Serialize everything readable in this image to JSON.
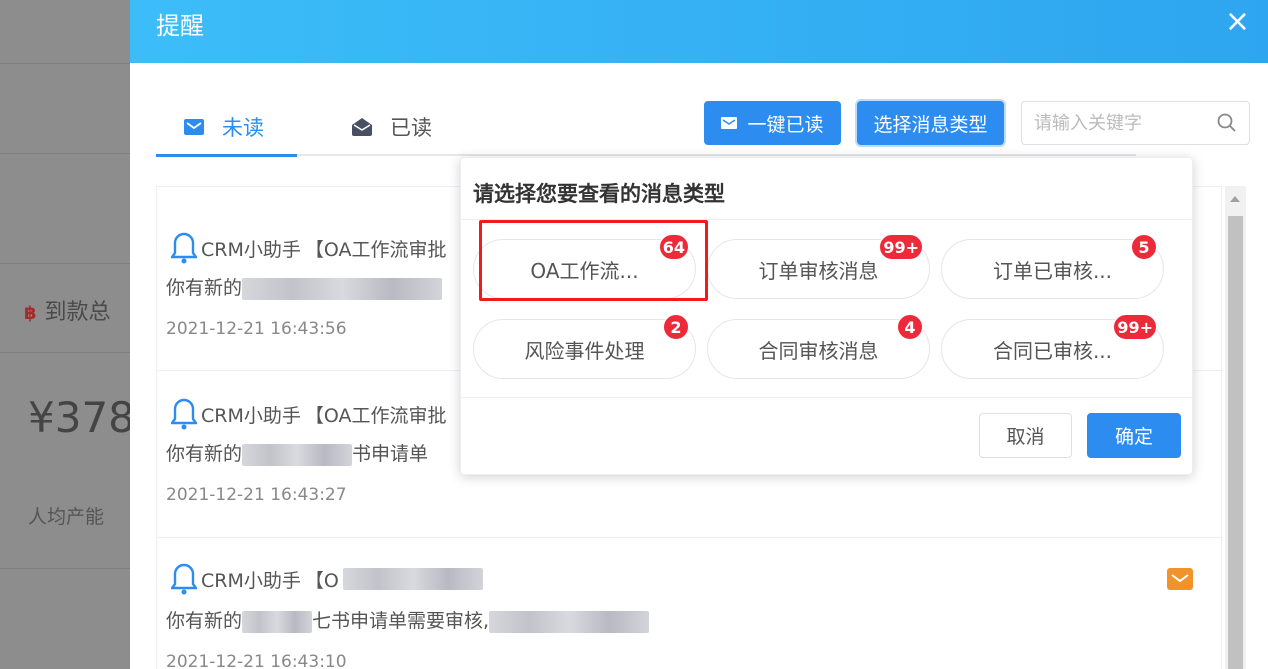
{
  "background": {
    "label": "到款总",
    "value": "¥378",
    "sub": "人均产能",
    "icon": "bitcoin-icon"
  },
  "dialog": {
    "title": "提醒",
    "close": "×"
  },
  "tabs": [
    {
      "label": "未读",
      "icon": "mail-icon",
      "active": true
    },
    {
      "label": "已读",
      "icon": "mail-open-icon",
      "active": false
    }
  ],
  "toolbar": {
    "mark_all_read": "一键已读",
    "select_type": "选择消息类型",
    "search_placeholder": "请输入关键字"
  },
  "messages": [
    {
      "sender": "CRM小助手",
      "subject": "【OA工作流审批",
      "body": "你有新的",
      "time": "2021-12-21 16:43:56"
    },
    {
      "sender": "CRM小助手",
      "subject": "【OA工作流审批",
      "body": "你有新的",
      "body_tail": "书申请单",
      "time": "2021-12-21 16:43:27"
    },
    {
      "sender": "CRM小助手",
      "subject": "【O",
      "body": "你有新的",
      "body_tail": "七书申请单需要审核,",
      "time": "2021-12-21 16:43:10"
    }
  ],
  "popover": {
    "title": "请选择您要查看的消息类型",
    "types": [
      {
        "label": "OA工作流...",
        "count": "64",
        "selected": true
      },
      {
        "label": "订单审核消息",
        "count": "99+"
      },
      {
        "label": "订单已审核...",
        "count": "5"
      },
      {
        "label": "风险事件处理",
        "count": "2"
      },
      {
        "label": "合同审核消息",
        "count": "4"
      },
      {
        "label": "合同已审核...",
        "count": "99+"
      }
    ],
    "cancel": "取消",
    "confirm": "确定"
  },
  "colors": {
    "primary": "#2d8cf0",
    "badge": "#ed2a3a",
    "highlight": "#f31a1a",
    "unread_mail": "#f0932b"
  }
}
